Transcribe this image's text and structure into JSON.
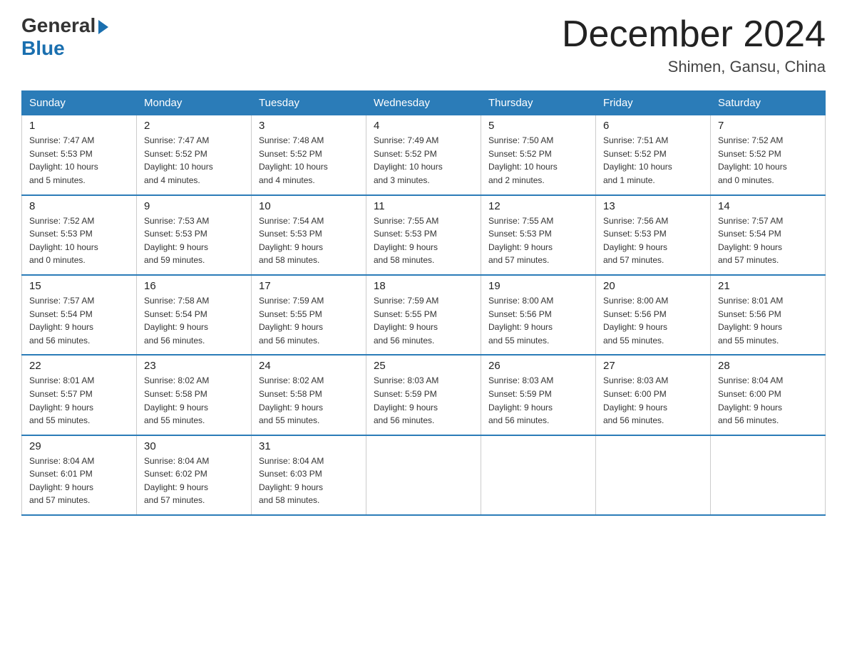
{
  "logo": {
    "general": "General",
    "blue": "Blue"
  },
  "title": "December 2024",
  "location": "Shimen, Gansu, China",
  "weekdays": [
    "Sunday",
    "Monday",
    "Tuesday",
    "Wednesday",
    "Thursday",
    "Friday",
    "Saturday"
  ],
  "weeks": [
    [
      {
        "day": "1",
        "info": "Sunrise: 7:47 AM\nSunset: 5:53 PM\nDaylight: 10 hours\nand 5 minutes."
      },
      {
        "day": "2",
        "info": "Sunrise: 7:47 AM\nSunset: 5:52 PM\nDaylight: 10 hours\nand 4 minutes."
      },
      {
        "day": "3",
        "info": "Sunrise: 7:48 AM\nSunset: 5:52 PM\nDaylight: 10 hours\nand 4 minutes."
      },
      {
        "day": "4",
        "info": "Sunrise: 7:49 AM\nSunset: 5:52 PM\nDaylight: 10 hours\nand 3 minutes."
      },
      {
        "day": "5",
        "info": "Sunrise: 7:50 AM\nSunset: 5:52 PM\nDaylight: 10 hours\nand 2 minutes."
      },
      {
        "day": "6",
        "info": "Sunrise: 7:51 AM\nSunset: 5:52 PM\nDaylight: 10 hours\nand 1 minute."
      },
      {
        "day": "7",
        "info": "Sunrise: 7:52 AM\nSunset: 5:52 PM\nDaylight: 10 hours\nand 0 minutes."
      }
    ],
    [
      {
        "day": "8",
        "info": "Sunrise: 7:52 AM\nSunset: 5:53 PM\nDaylight: 10 hours\nand 0 minutes."
      },
      {
        "day": "9",
        "info": "Sunrise: 7:53 AM\nSunset: 5:53 PM\nDaylight: 9 hours\nand 59 minutes."
      },
      {
        "day": "10",
        "info": "Sunrise: 7:54 AM\nSunset: 5:53 PM\nDaylight: 9 hours\nand 58 minutes."
      },
      {
        "day": "11",
        "info": "Sunrise: 7:55 AM\nSunset: 5:53 PM\nDaylight: 9 hours\nand 58 minutes."
      },
      {
        "day": "12",
        "info": "Sunrise: 7:55 AM\nSunset: 5:53 PM\nDaylight: 9 hours\nand 57 minutes."
      },
      {
        "day": "13",
        "info": "Sunrise: 7:56 AM\nSunset: 5:53 PM\nDaylight: 9 hours\nand 57 minutes."
      },
      {
        "day": "14",
        "info": "Sunrise: 7:57 AM\nSunset: 5:54 PM\nDaylight: 9 hours\nand 57 minutes."
      }
    ],
    [
      {
        "day": "15",
        "info": "Sunrise: 7:57 AM\nSunset: 5:54 PM\nDaylight: 9 hours\nand 56 minutes."
      },
      {
        "day": "16",
        "info": "Sunrise: 7:58 AM\nSunset: 5:54 PM\nDaylight: 9 hours\nand 56 minutes."
      },
      {
        "day": "17",
        "info": "Sunrise: 7:59 AM\nSunset: 5:55 PM\nDaylight: 9 hours\nand 56 minutes."
      },
      {
        "day": "18",
        "info": "Sunrise: 7:59 AM\nSunset: 5:55 PM\nDaylight: 9 hours\nand 56 minutes."
      },
      {
        "day": "19",
        "info": "Sunrise: 8:00 AM\nSunset: 5:56 PM\nDaylight: 9 hours\nand 55 minutes."
      },
      {
        "day": "20",
        "info": "Sunrise: 8:00 AM\nSunset: 5:56 PM\nDaylight: 9 hours\nand 55 minutes."
      },
      {
        "day": "21",
        "info": "Sunrise: 8:01 AM\nSunset: 5:56 PM\nDaylight: 9 hours\nand 55 minutes."
      }
    ],
    [
      {
        "day": "22",
        "info": "Sunrise: 8:01 AM\nSunset: 5:57 PM\nDaylight: 9 hours\nand 55 minutes."
      },
      {
        "day": "23",
        "info": "Sunrise: 8:02 AM\nSunset: 5:58 PM\nDaylight: 9 hours\nand 55 minutes."
      },
      {
        "day": "24",
        "info": "Sunrise: 8:02 AM\nSunset: 5:58 PM\nDaylight: 9 hours\nand 55 minutes."
      },
      {
        "day": "25",
        "info": "Sunrise: 8:03 AM\nSunset: 5:59 PM\nDaylight: 9 hours\nand 56 minutes."
      },
      {
        "day": "26",
        "info": "Sunrise: 8:03 AM\nSunset: 5:59 PM\nDaylight: 9 hours\nand 56 minutes."
      },
      {
        "day": "27",
        "info": "Sunrise: 8:03 AM\nSunset: 6:00 PM\nDaylight: 9 hours\nand 56 minutes."
      },
      {
        "day": "28",
        "info": "Sunrise: 8:04 AM\nSunset: 6:00 PM\nDaylight: 9 hours\nand 56 minutes."
      }
    ],
    [
      {
        "day": "29",
        "info": "Sunrise: 8:04 AM\nSunset: 6:01 PM\nDaylight: 9 hours\nand 57 minutes."
      },
      {
        "day": "30",
        "info": "Sunrise: 8:04 AM\nSunset: 6:02 PM\nDaylight: 9 hours\nand 57 minutes."
      },
      {
        "day": "31",
        "info": "Sunrise: 8:04 AM\nSunset: 6:03 PM\nDaylight: 9 hours\nand 58 minutes."
      },
      null,
      null,
      null,
      null
    ]
  ]
}
